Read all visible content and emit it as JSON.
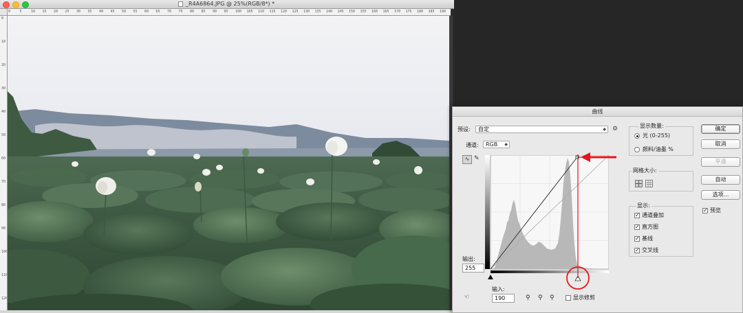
{
  "document": {
    "title": "_R4A6864.JPG @ 25%(RGB/8*) *",
    "ruler_h_labels": [
      "0",
      "5",
      "10",
      "15",
      "20",
      "25",
      "30",
      "35",
      "40",
      "45",
      "50",
      "55",
      "60",
      "65",
      "70",
      "75",
      "80",
      "85",
      "90",
      "95",
      "100",
      "105",
      "110",
      "115",
      "120",
      "125",
      "130",
      "135",
      "140",
      "145",
      "150",
      "155",
      "160",
      "165",
      "170",
      "175",
      "180",
      "185",
      "190"
    ],
    "ruler_v_labels": [
      "0",
      "10",
      "20",
      "30",
      "40",
      "50",
      "60",
      "70",
      "80",
      "90",
      "100",
      "110",
      "120"
    ]
  },
  "curves_dialog": {
    "title": "曲线",
    "preset_label": "预设:",
    "preset_value": "自定",
    "channel_label": "通道:",
    "channel_value": "RGB",
    "output_label": "输出:",
    "output_value": "255",
    "input_label": "输入:",
    "input_value": "190",
    "show_clipping_label": "显示修剪",
    "show_amount": {
      "title": "显示数量:",
      "option_light": "光 (0-255)",
      "option_pigment": "颜料/油墨 %"
    },
    "grid_size_title": "网格大小:",
    "show_options": {
      "title": "显示:",
      "items": [
        "通道叠加",
        "直方图",
        "基线",
        "交叉线"
      ]
    },
    "buttons": {
      "ok": "确定",
      "cancel": "取消",
      "smooth": "平滑",
      "auto": "自动",
      "options": "选项..."
    },
    "preview_label": "预览",
    "annotation_color": "#e8151b"
  }
}
